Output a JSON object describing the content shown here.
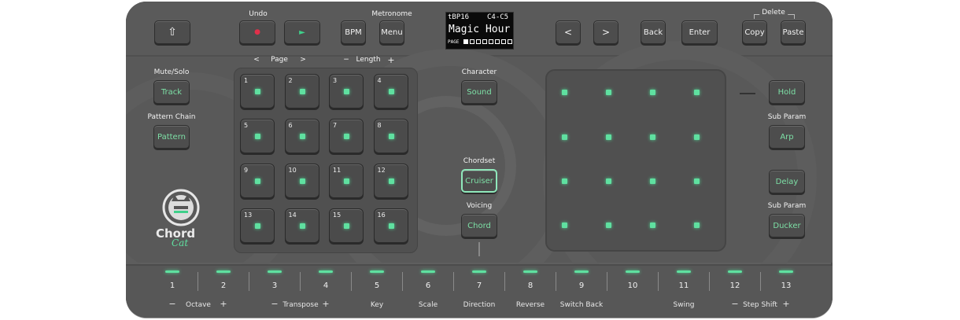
{
  "top": {
    "shift_icon": "⇧",
    "undo_label": "Undo",
    "metronome_label": "Metronome",
    "record_icon": "●",
    "play_icon": "►",
    "bpm": "BPM",
    "menu": "Menu",
    "prev": "<",
    "next": ">",
    "back": "Back",
    "enter": "Enter",
    "delete_label": "Delete",
    "copy": "Copy",
    "paste": "Paste"
  },
  "screen": {
    "tempo": "tBP16",
    "range": "C4-C5",
    "title": "Magic Hour",
    "page_label": "PAGE"
  },
  "left": {
    "mute_solo": "Mute/Solo",
    "track": "Track",
    "pattern_chain": "Pattern Chain",
    "pattern": "Pattern"
  },
  "page_nav": {
    "prev": "<",
    "label": "Page",
    "next": ">"
  },
  "length_nav": {
    "minus": "−",
    "label": "Length",
    "plus": "+"
  },
  "pads": [
    "1",
    "2",
    "3",
    "4",
    "5",
    "6",
    "7",
    "8",
    "9",
    "10",
    "11",
    "12",
    "13",
    "14",
    "15",
    "16"
  ],
  "center": {
    "character": "Character",
    "sound": "Sound",
    "chordset": "Chordset",
    "cruiser": "Cruiser",
    "voicing": "Voicing",
    "chord": "Chord"
  },
  "right": {
    "hold": "Hold",
    "sub_param_1": "Sub Param",
    "arp": "Arp",
    "delay": "Delay",
    "sub_param_2": "Sub Param",
    "ducker": "Ducker"
  },
  "logo": {
    "line1": "Chord",
    "line2": "Cat"
  },
  "steps": [
    "1",
    "2",
    "3",
    "4",
    "5",
    "6",
    "7",
    "8",
    "9",
    "10",
    "11",
    "12",
    "13"
  ],
  "step_labels": {
    "octave": "Octave",
    "octave_minus": "−",
    "octave_plus": "+",
    "transpose": "Transpose",
    "transpose_minus": "−",
    "transpose_plus": "+",
    "key": "Key",
    "scale": "Scale",
    "direction": "Direction",
    "reverse": "Reverse",
    "switch_back": "Switch Back",
    "swing": "Swing",
    "step_shift": "Step Shift",
    "step_shift_minus": "−",
    "step_shift_plus": "+"
  },
  "colors": {
    "led_green": "#5fe0a0",
    "record_red": "#e0304a",
    "play_green": "#3fd08a",
    "body": "#5f5f5f"
  }
}
